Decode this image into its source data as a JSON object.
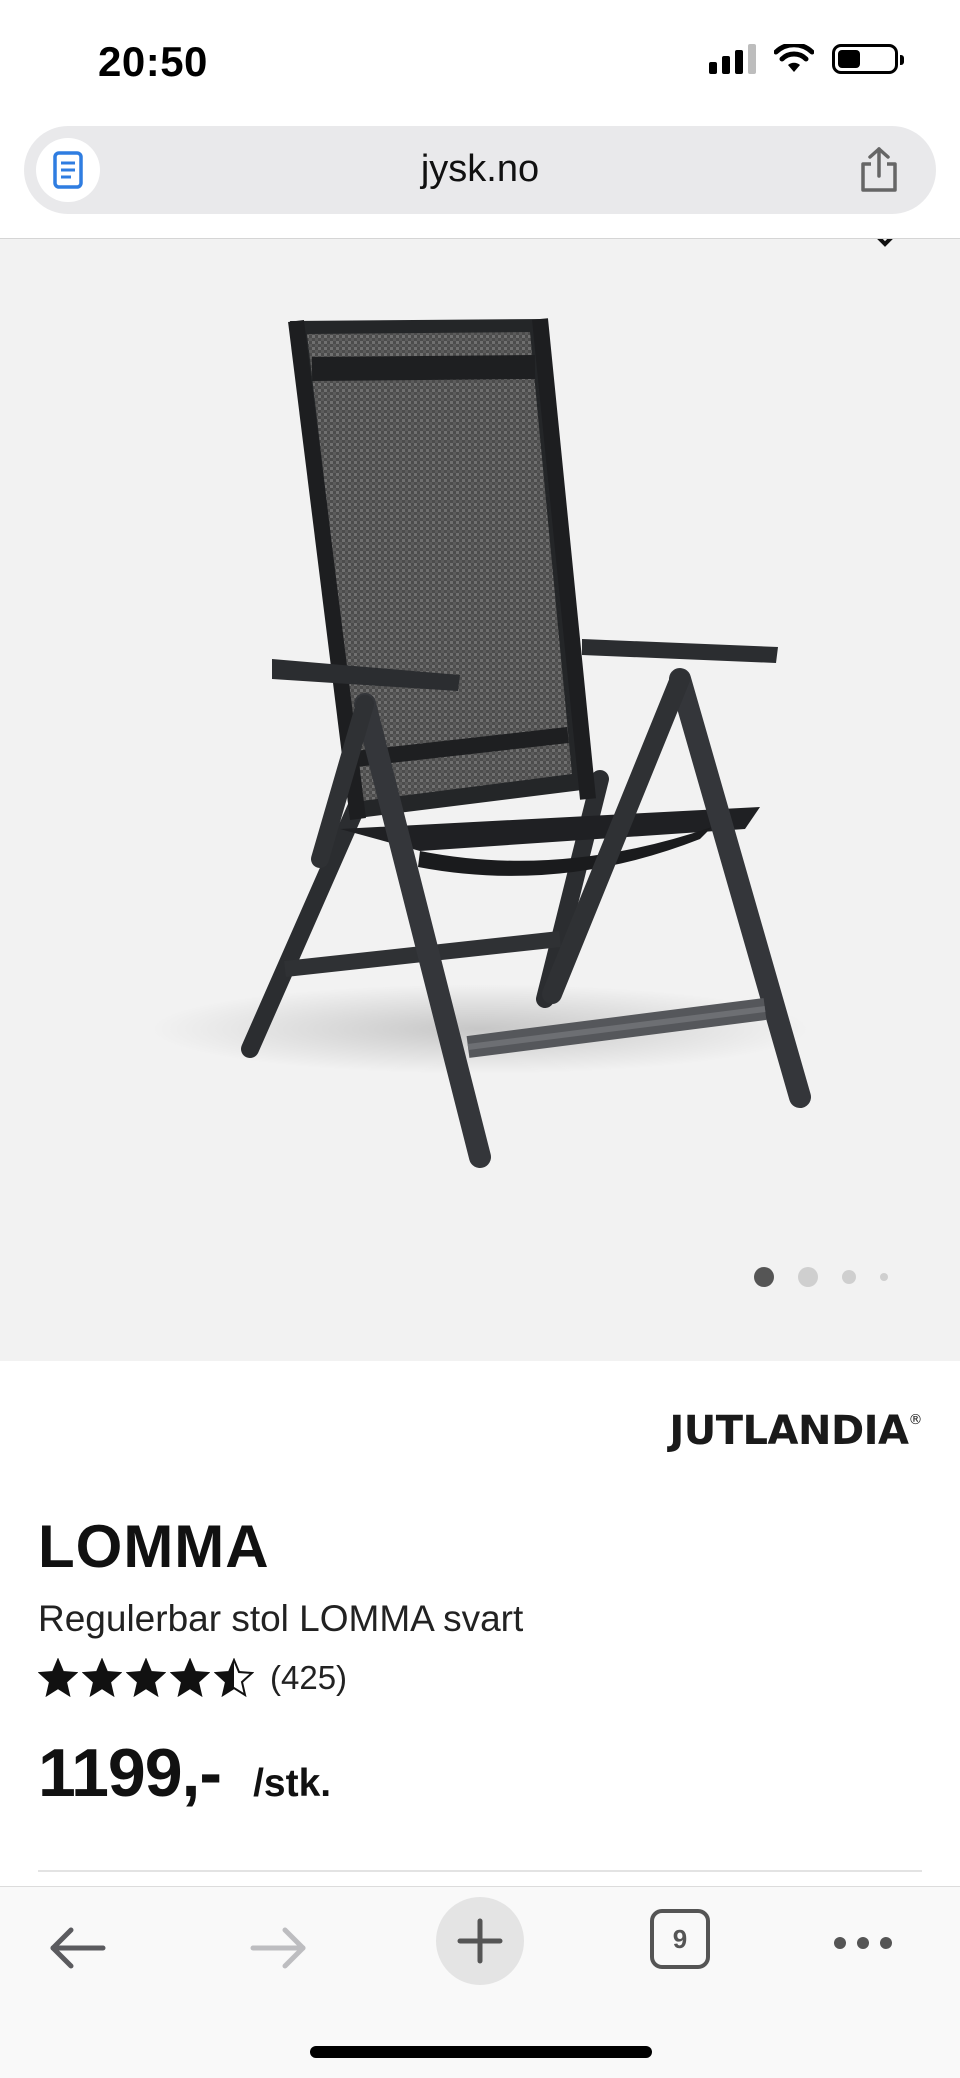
{
  "status_bar": {
    "time": "20:50",
    "battery_level": 0.35,
    "signal_bars": 3,
    "signal_bars_total": 4
  },
  "browser": {
    "url": "jysk.no",
    "open_tabs": "9"
  },
  "product_image": {
    "carousel_total": 4,
    "carousel_active": 1,
    "background": "#f2f2f2"
  },
  "product": {
    "brand": "JUTLANDIA",
    "brand_mark": "®",
    "name": "LOMMA",
    "description": "Regulerbar stol LOMMA svart",
    "rating": 4.5,
    "rating_max": 5,
    "review_count": "(425)",
    "price": "1199,-",
    "price_unit": "/stk."
  },
  "icons": {
    "reader": "document-icon",
    "share": "share-icon",
    "back": "arrow-left-icon",
    "forward": "arrow-right-icon",
    "new_tab": "plus-icon",
    "more": "ellipsis-icon"
  },
  "colors": {
    "accent_blue": "#2f7de1",
    "text": "#111111",
    "star": "#111111"
  }
}
